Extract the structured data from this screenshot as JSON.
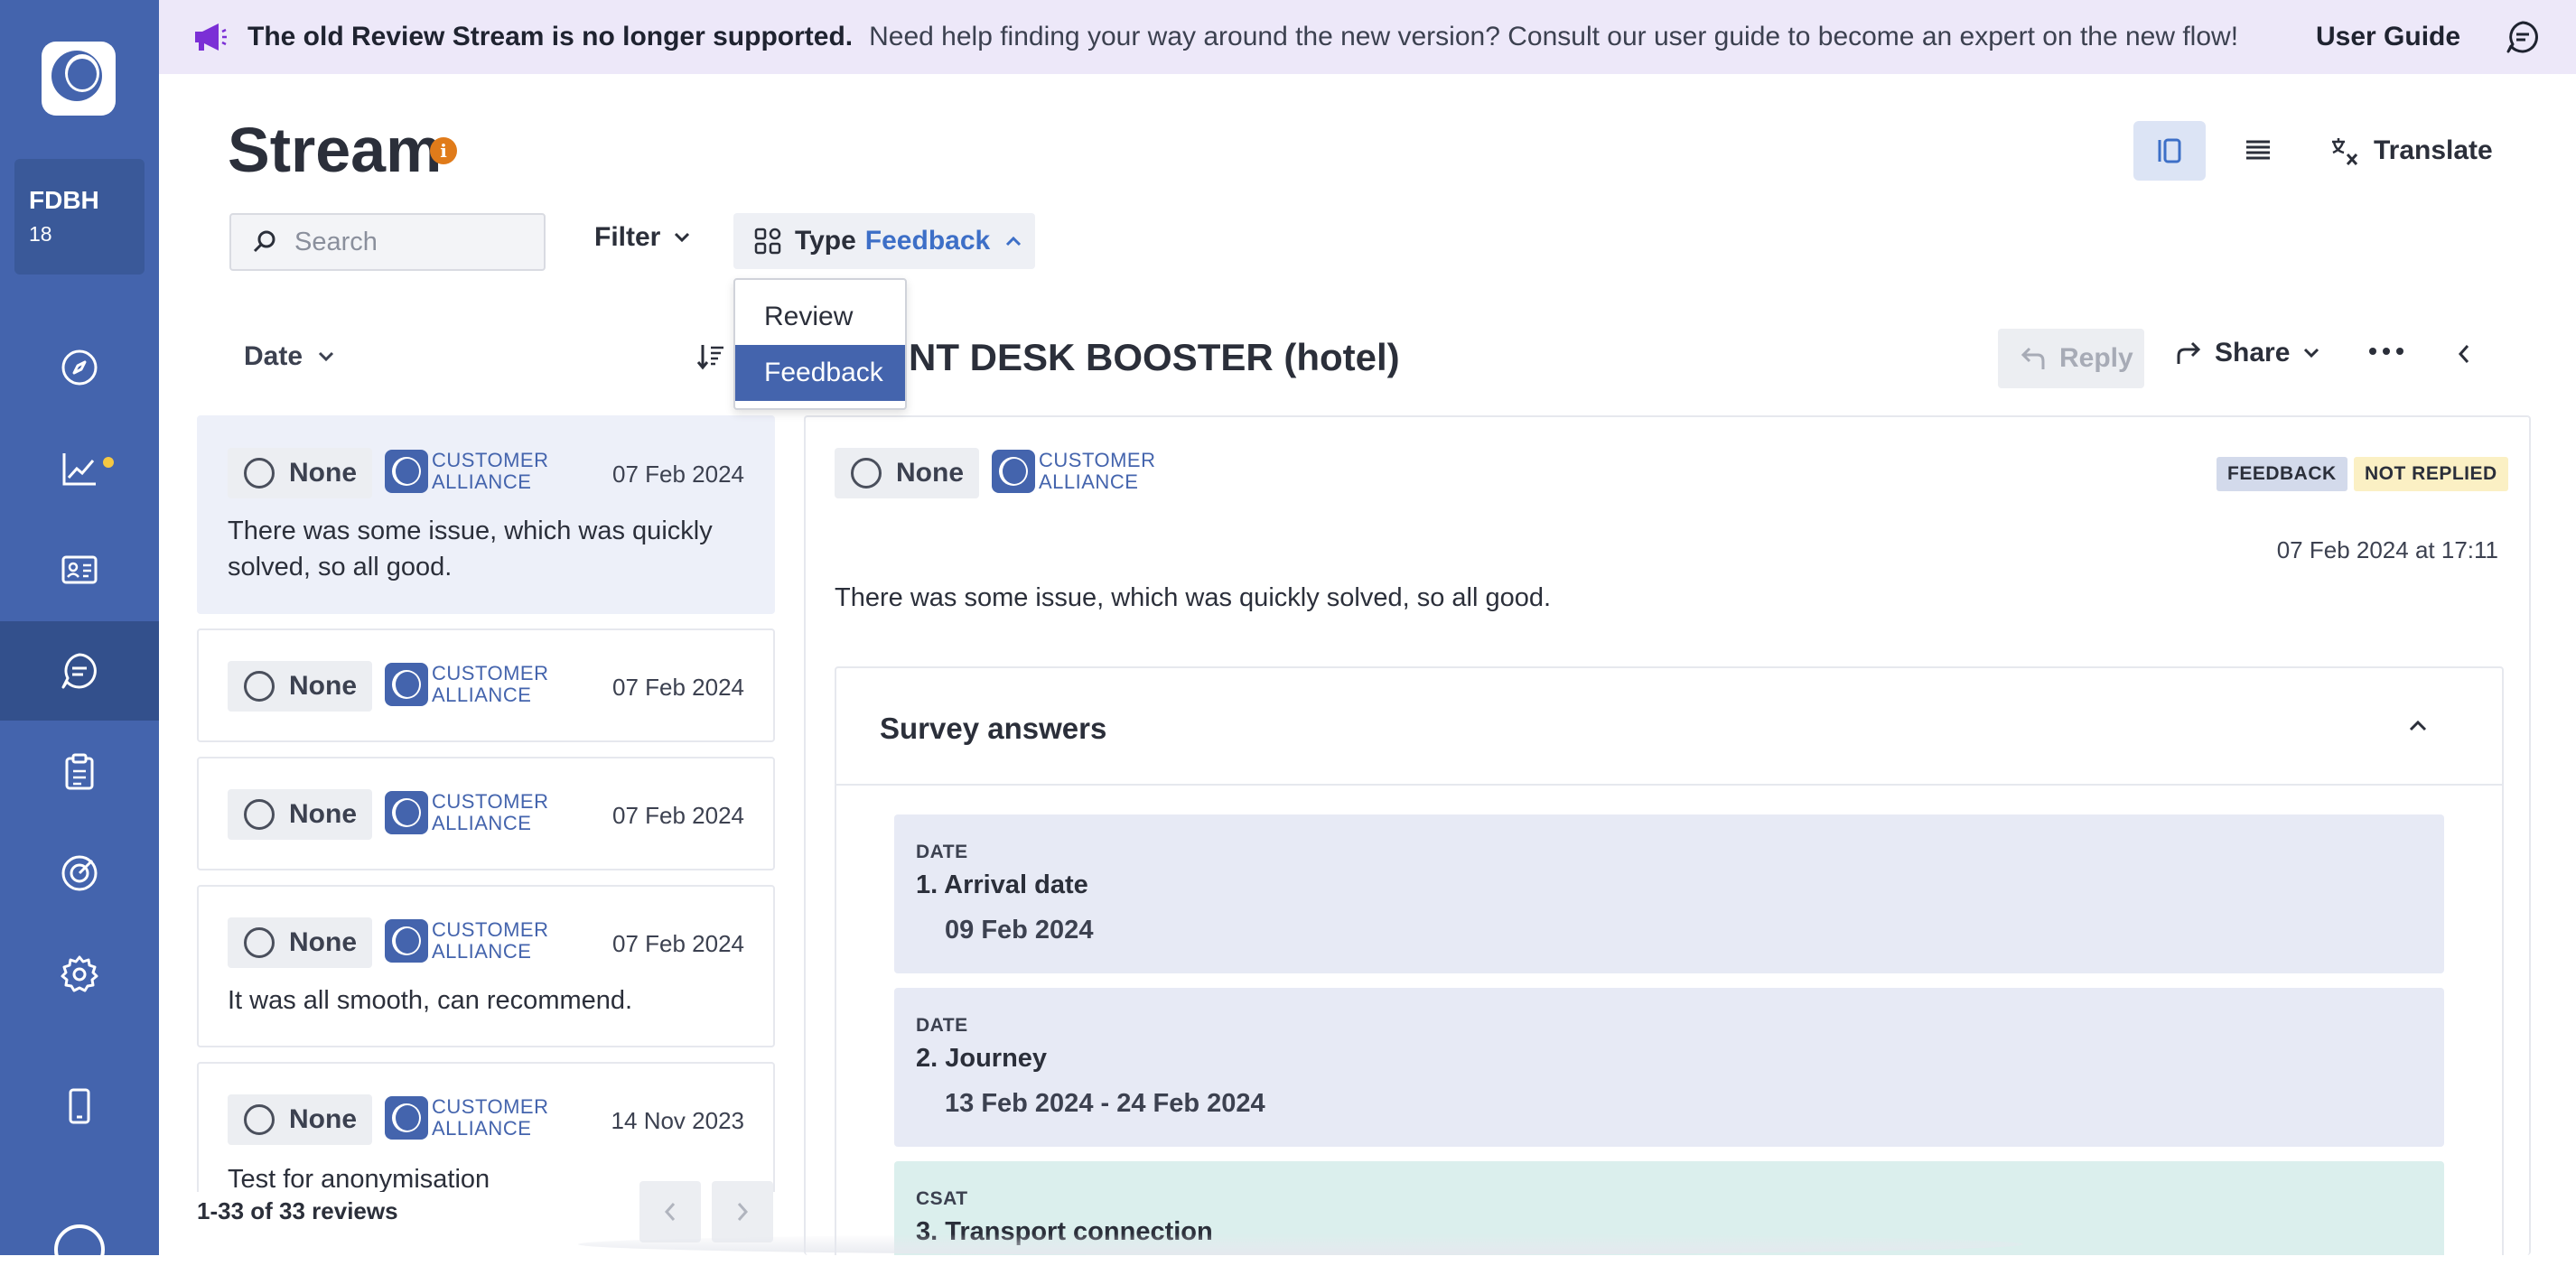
{
  "banner": {
    "title": "The old Review Stream is no longer supported.",
    "message": "Need help finding your way around the new version? Consult our user guide to become an expert on the new flow!",
    "guide_link": "User Guide"
  },
  "sidebar": {
    "account_name": "FDBH",
    "account_count": "18",
    "items": [
      {
        "icon": "compass-icon"
      },
      {
        "icon": "chart-icon",
        "notification": true
      },
      {
        "icon": "contact-card-icon"
      },
      {
        "icon": "chat-icon",
        "active": true
      },
      {
        "icon": "clipboard-icon"
      },
      {
        "icon": "target-icon"
      },
      {
        "icon": "gear-icon"
      },
      {
        "icon": "mobile-icon"
      }
    ]
  },
  "page": {
    "title": "Stream",
    "info_glyph": "i",
    "translate_label": "Translate"
  },
  "toolbar": {
    "search_placeholder": "Search",
    "filter_label": "Filter",
    "type_label": "Type",
    "type_value": "Feedback",
    "type_options": [
      "Review",
      "Feedback"
    ],
    "sort_label": "Date"
  },
  "list": {
    "items": [
      {
        "status": "None",
        "source": [
          "CUSTOMER",
          "ALLIANCE"
        ],
        "date": "07 Feb 2024",
        "text": "There was some issue, which was quickly solved, so all good.",
        "selected": true
      },
      {
        "status": "None",
        "source": [
          "CUSTOMER",
          "ALLIANCE"
        ],
        "date": "07 Feb 2024",
        "text": ""
      },
      {
        "status": "None",
        "source": [
          "CUSTOMER",
          "ALLIANCE"
        ],
        "date": "07 Feb 2024",
        "text": ""
      },
      {
        "status": "None",
        "source": [
          "CUSTOMER",
          "ALLIANCE"
        ],
        "date": "07 Feb 2024",
        "text": "It was all smooth, can recommend."
      },
      {
        "status": "None",
        "source": [
          "CUSTOMER",
          "ALLIANCE"
        ],
        "date": "14 Nov 2023",
        "text": "Test for anonymisation"
      }
    ],
    "footer": "1-33 of 33 reviews"
  },
  "detail": {
    "title": "NT DESK BOOSTER (hotel)",
    "reply_label": "Reply",
    "share_label": "Share",
    "status": "None",
    "source": [
      "CUSTOMER",
      "ALLIANCE"
    ],
    "badges": [
      "FEEDBACK",
      "NOT REPLIED"
    ],
    "datetime": "07 Feb 2024 at 17:11",
    "text": "There was some issue, which was quickly solved, so all good.",
    "survey": {
      "title": "Survey answers",
      "answers": [
        {
          "type": "DATE",
          "question": "1. Arrival date",
          "value": "09 Feb 2024"
        },
        {
          "type": "DATE",
          "question": "2. Journey",
          "value": "13 Feb 2024 - 24 Feb 2024"
        },
        {
          "type": "CSAT",
          "question": "3. Transport connection",
          "value": ""
        }
      ]
    }
  },
  "colors": {
    "sidebar": "#4464ad",
    "accent": "#3d6fc7",
    "banner_bg": "#ede8f9",
    "info": "#e07b1a"
  }
}
